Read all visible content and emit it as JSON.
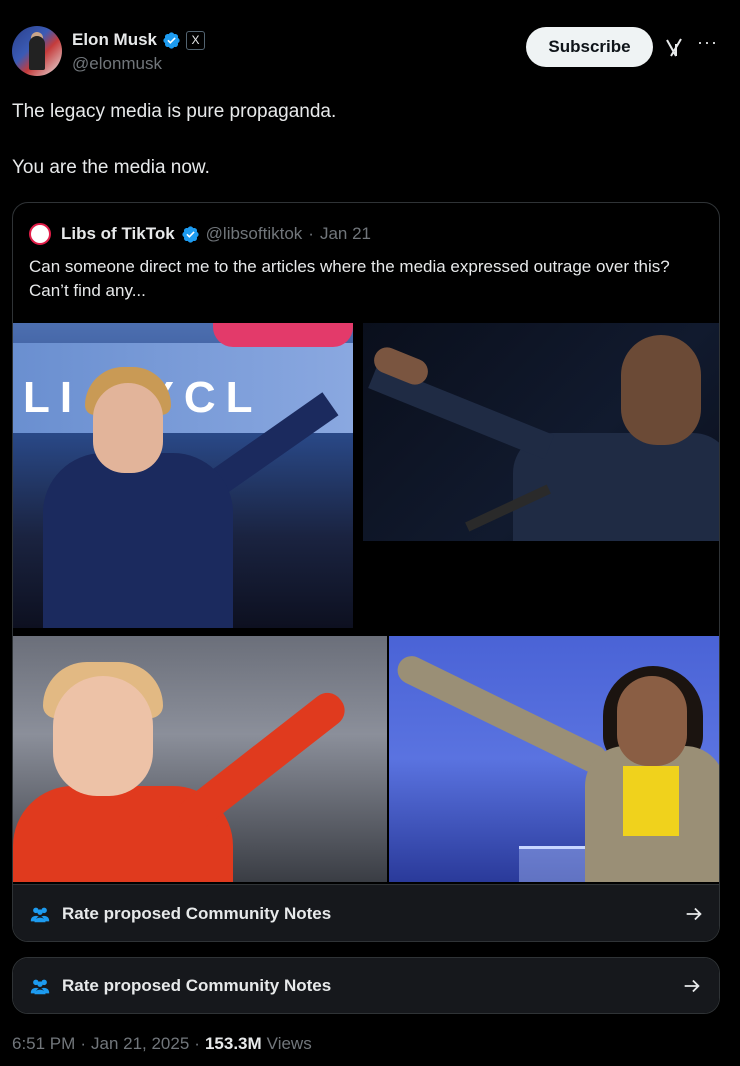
{
  "author": {
    "name": "Elon Musk",
    "handle": "@elonmusk",
    "badge_label": "X"
  },
  "subscribe_label": "Subscribe",
  "more_label": "···",
  "tweet": {
    "line1": "The legacy media is pure propaganda.",
    "line2": "You are the media now."
  },
  "quoted": {
    "name": "Libs of TikTok",
    "handle": "@libsoftiktok",
    "separator": "·",
    "date": "Jan 21",
    "text": "Can someone direct me to the articles where the media expressed outrage over this? Can’t find any...",
    "image_banner_text": "LI RYCL",
    "notes_label": "Rate proposed Community Notes"
  },
  "notes_label": "Rate proposed Community Notes",
  "meta": {
    "time": "6:51 PM",
    "sep1": "·",
    "date": "Jan 21, 2025",
    "sep2": "·",
    "views_count": "153.3M",
    "views_label": "Views"
  },
  "colors": {
    "accent": "#1d9bf0",
    "background": "#000000",
    "text": "#e7e9ea",
    "muted": "#71767b"
  }
}
